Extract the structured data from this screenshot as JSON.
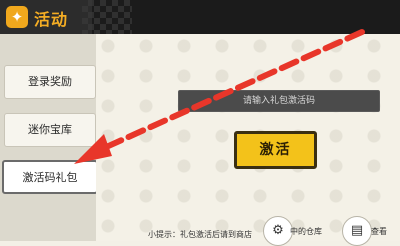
{
  "header": {
    "title": "活动",
    "icon": "activity-icon"
  },
  "sidebar": {
    "items": [
      {
        "label": "登录奖励"
      },
      {
        "label": "迷你宝库"
      },
      {
        "label": "激活码礼包",
        "active": true
      }
    ]
  },
  "main": {
    "code_input_placeholder": "请输入礼包激活码",
    "activate_label": "激活",
    "tip": "小提示：礼包激活后请到商店",
    "warehouse_label": "中的仓库",
    "view_label": "查看"
  },
  "annotation": {
    "arrow_color": "#e8362a",
    "points_to": "sidebar-item-gift-code"
  },
  "colors": {
    "header_bg": "#1b1b1b",
    "title": "#f4ad24",
    "accent_button": "#f3c21a",
    "input_bg": "#4b4b4b"
  }
}
